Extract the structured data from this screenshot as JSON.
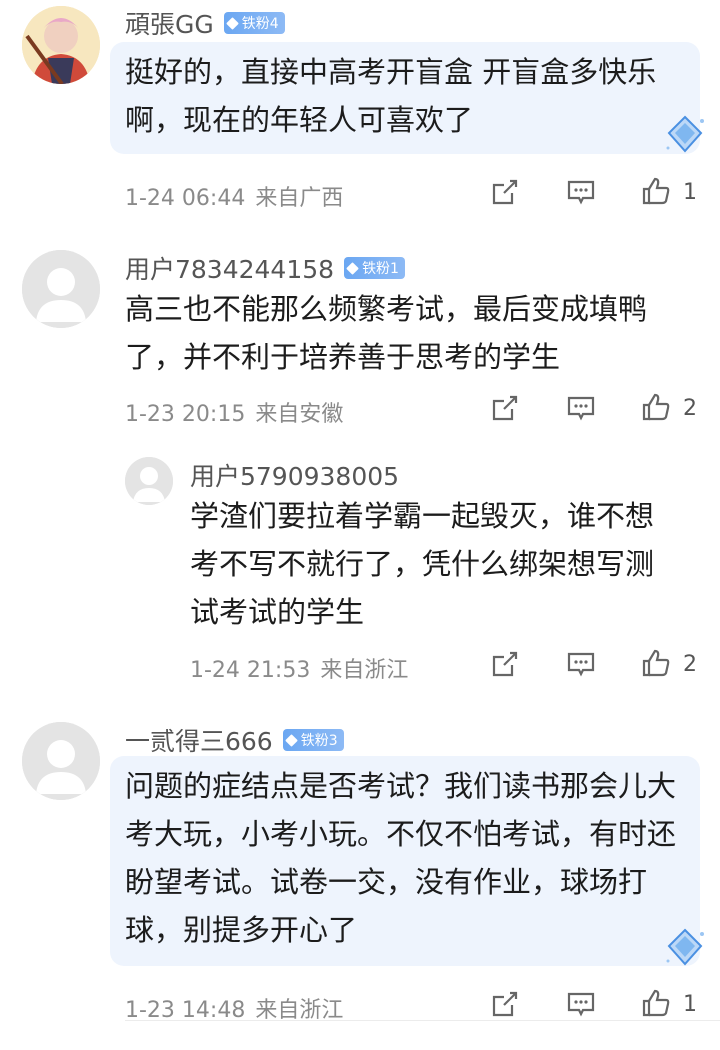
{
  "comments": [
    {
      "user": "頑張GG",
      "badge": "铁粉4",
      "text": "挺好的，直接中高考开盲盒 开盲盒多快乐啊，现在的年轻人可喜欢了",
      "time": "1-24 06:44",
      "location": "来自广西",
      "likes": "1",
      "avatar": "anime-avatar"
    },
    {
      "user": "用户7834244158",
      "badge": "铁粉1",
      "text": "高三也不能那么频繁考试，最后变成填鸭了，并不利于培养善于思考的学生",
      "time": "1-23 20:15",
      "location": "来自安徽",
      "likes": "2",
      "avatar": "default-avatar"
    },
    {
      "user": "用户5790938005",
      "badge": "",
      "text": "学渣们要拉着学霸一起毁灭，谁不想考不写不就行了，凭什么绑架想写测试考试的学生",
      "time": "1-24 21:53",
      "location": "来自浙江",
      "likes": "2",
      "avatar": "default-avatar"
    },
    {
      "user": "一贰得三666",
      "badge": "铁粉3",
      "text": "问题的症结点是否考试？我们读书那会儿大考大玩，小考小玩。不仅不怕考试，有时还盼望考试。试卷一交，没有作业，球场打球，别提多开心了",
      "time": "1-23 14:48",
      "location": "来自浙江",
      "likes": "1",
      "avatar": "default-avatar"
    }
  ],
  "icons": {
    "share": "share-icon",
    "comment": "comment-icon",
    "like": "thumbs-up-icon",
    "gem": "diamond-gem-icon"
  },
  "colors": {
    "bubble": "#eef4fd",
    "badge": "#6ba7f2",
    "meta_text": "#8a8a8a"
  }
}
